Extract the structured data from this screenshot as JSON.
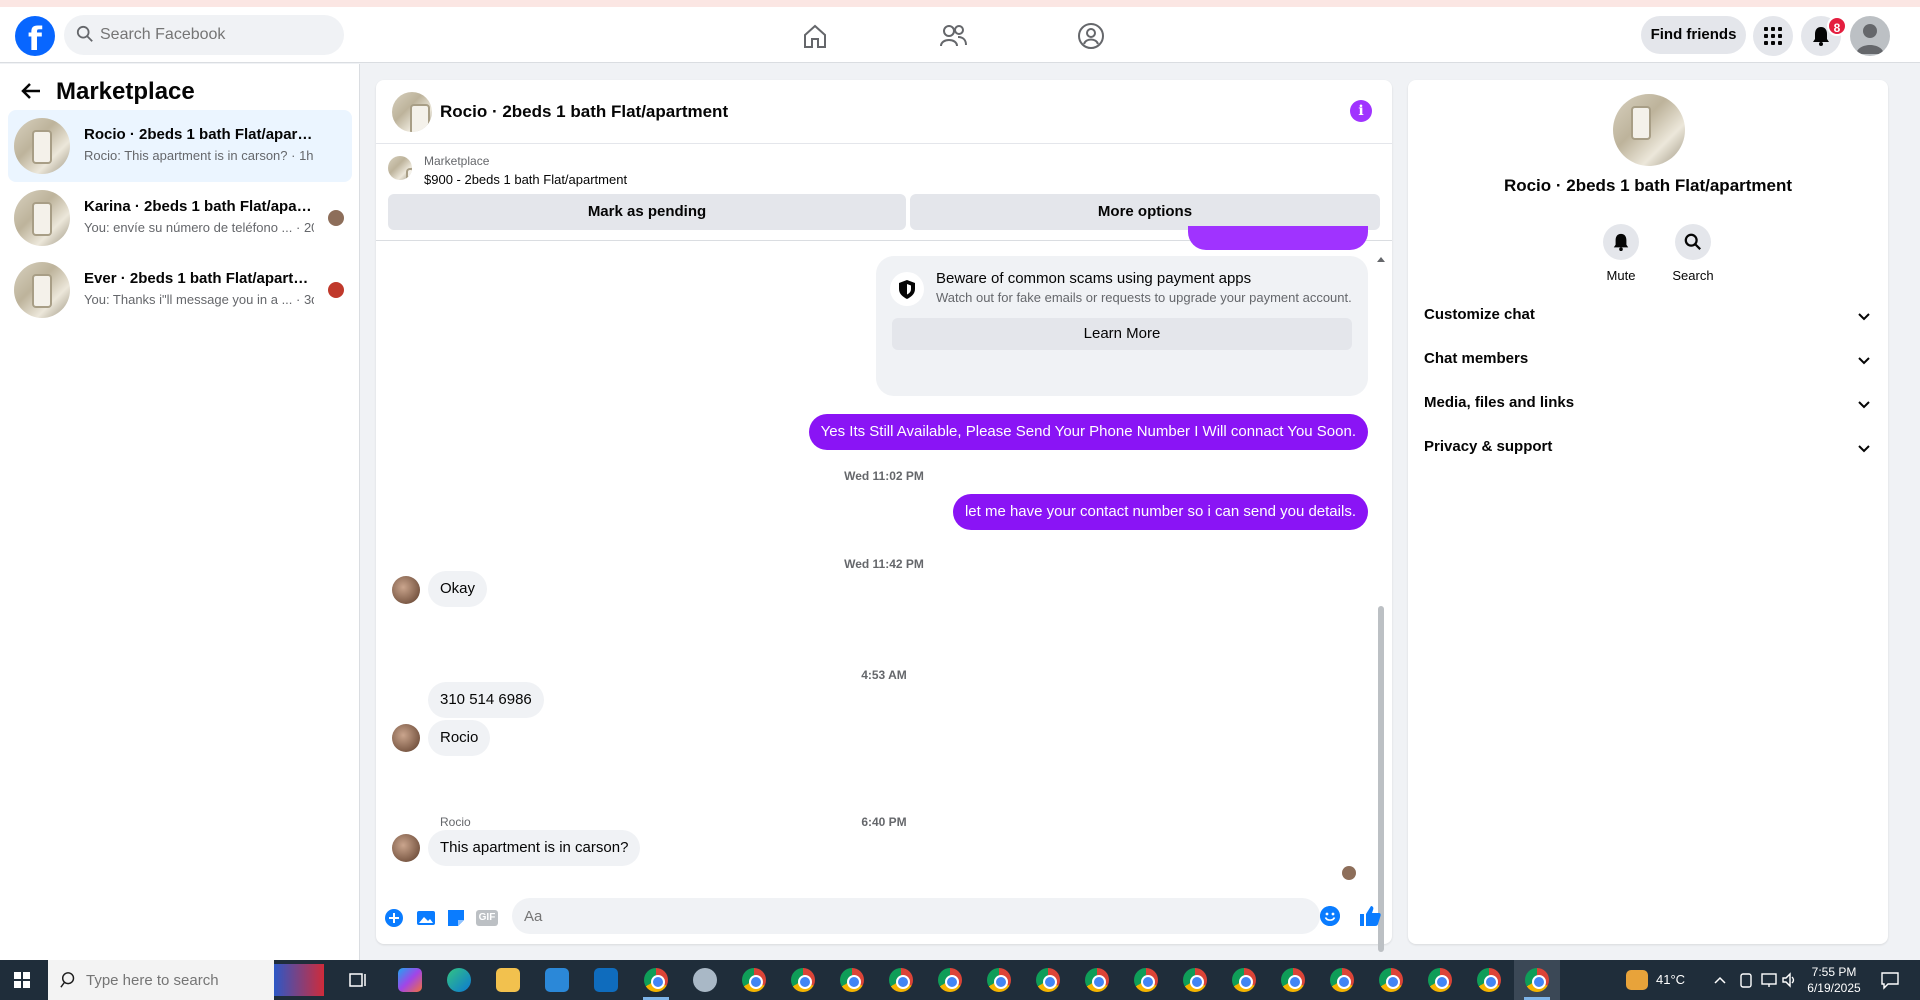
{
  "nav": {
    "search_placeholder": "Search Facebook",
    "find_friends_label": "Find friends",
    "notifications_count": "8"
  },
  "sidebar": {
    "title": "Marketplace",
    "conversations": [
      {
        "title": "Rocio · 2beds 1 bath Flat/apartment",
        "snippet": "Rocio: This apartment is in carson? · 1h",
        "active": true
      },
      {
        "title": "Karina · 2beds 1 bath Flat/apart...",
        "snippet": "You: envíe su número de teléfono ... · 20h"
      },
      {
        "title": "Ever · 2beds 1 bath Flat/apartme...",
        "snippet": "You: Thanks i\"ll message you in a ... · 3d"
      }
    ]
  },
  "chat": {
    "title": "Rocio · 2beds 1 bath Flat/apartment",
    "marketplace_label": "Marketplace",
    "listing": "$900 - 2beds 1 bath Flat/apartment",
    "mark_pending_label": "Mark as pending",
    "more_options_label": "More options",
    "scam_title": "Beware of common scams using payment apps",
    "scam_subtitle": "Watch out for fake emails or requests to upgrade your payment account.",
    "learn_more_label": "Learn More",
    "messages": {
      "out1": "Yes Its Still Available, Please Send Your Phone Number I Will connact You Soon.",
      "ts1": "Wed 11:02 PM",
      "out2": "let me have your contact number so i can send you details.",
      "ts2": "Wed 11:42 PM",
      "sender": "Rocio",
      "in1": "Okay",
      "ts3": "4:53 AM",
      "in2": "310 514 6986",
      "in3": "Rocio",
      "ts4": "6:40 PM",
      "in4": "This apartment is in carson?"
    },
    "input_placeholder": "Aa"
  },
  "details": {
    "title": "Rocio · 2beds 1 bath Flat/apartment",
    "mute_label": "Mute",
    "search_label": "Search",
    "sections": [
      "Customize chat",
      "Chat members",
      "Media, files and links",
      "Privacy & support"
    ]
  },
  "taskbar": {
    "search_placeholder": "Type here to search",
    "weather": "41°C",
    "time": "7:55 PM",
    "date": "6/19/2025"
  },
  "colors": {
    "accent": "#8a14f5",
    "brand": "#0866ff",
    "badge": "#e41e3f"
  }
}
